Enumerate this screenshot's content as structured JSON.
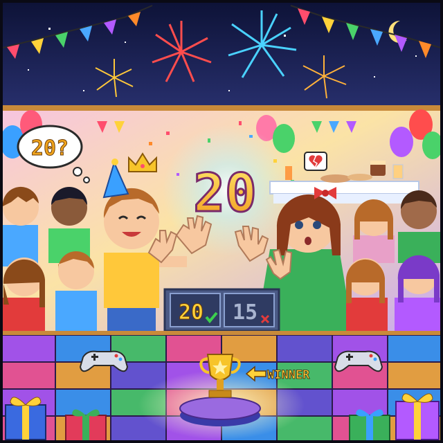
{
  "game": {
    "thought_bubble_text": "20?",
    "center_number": "20",
    "winner_label": "WINNER",
    "scores": [
      {
        "value": "20",
        "result_icon": "check-icon",
        "result_color": "#3ccf4e"
      },
      {
        "value": "15",
        "result_icon": "x-icon",
        "result_color": "#e23b3b"
      }
    ],
    "icons": {
      "crown": "crown-icon",
      "trophy": "trophy-icon",
      "arrow": "arrow-left-icon",
      "controller": "gamepad-icon",
      "heart": "broken-heart-icon",
      "moon": "moon-icon"
    }
  },
  "colors": {
    "sky": "#131a4f",
    "wall_top": "#f7d28a",
    "wall_bottom": "#f2a3d6",
    "gold": "#f7b928",
    "score_panel": "#3a4a72"
  }
}
